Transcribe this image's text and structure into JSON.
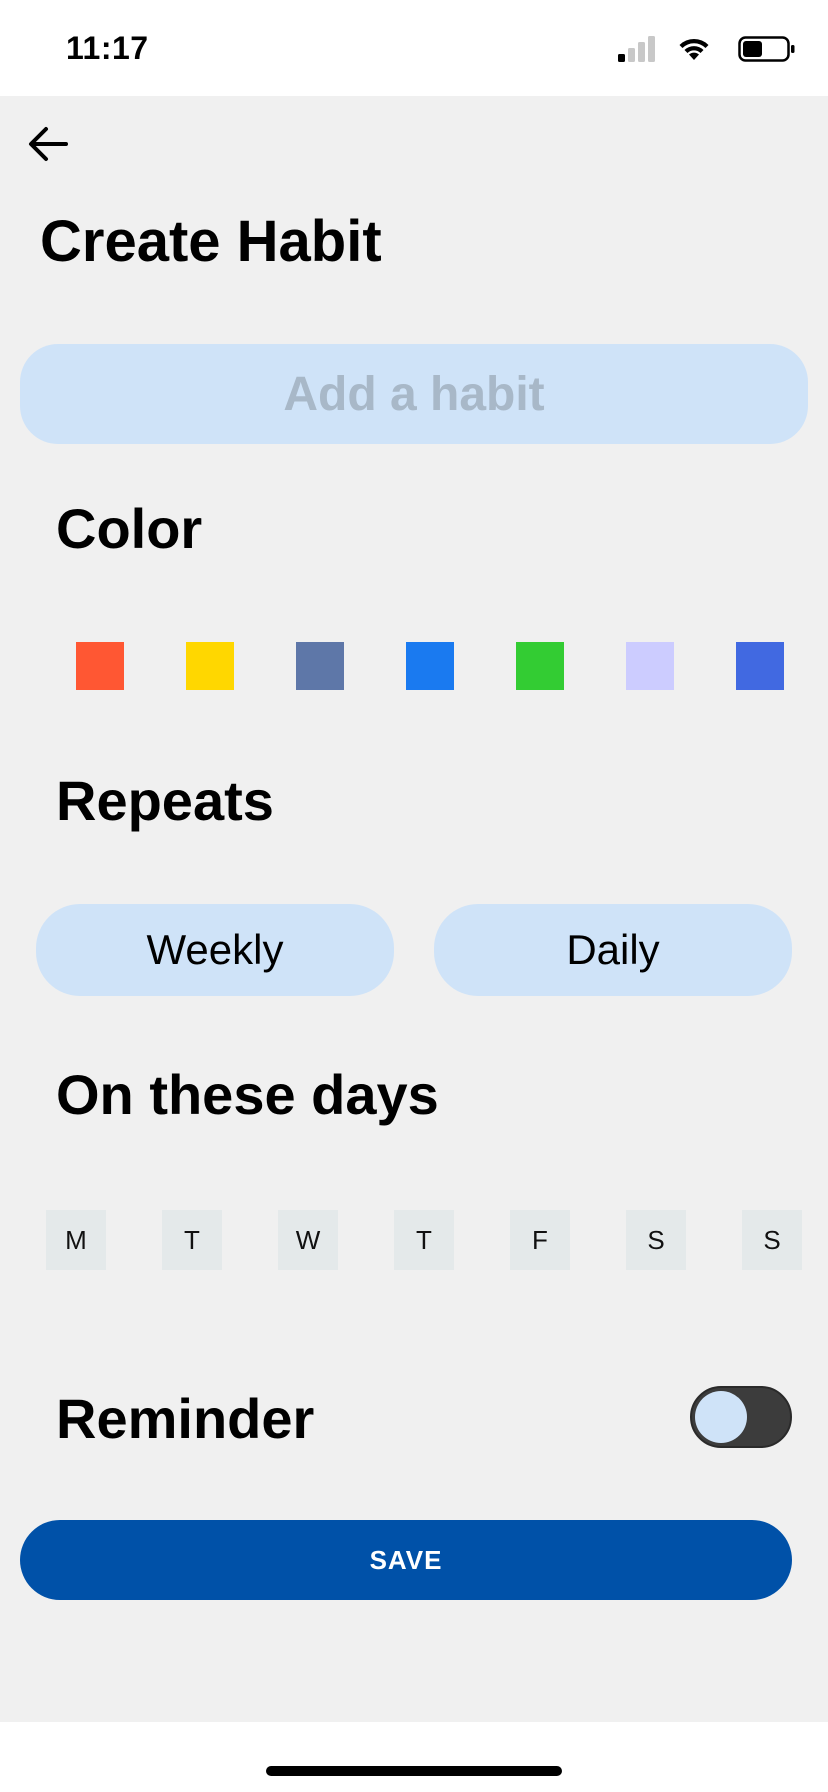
{
  "status_bar": {
    "time": "11:17",
    "signal_icon": "cellular-signal-icon",
    "wifi_icon": "wifi-icon",
    "battery_icon": "battery-icon",
    "battery_level": 0.45
  },
  "header": {
    "back_icon": "arrow-left-icon",
    "title": "Create Habit"
  },
  "habit_input": {
    "placeholder": "Add a habit",
    "value": ""
  },
  "color_section": {
    "heading": "Color",
    "swatches": [
      "#ff5733",
      "#ffd700",
      "#5e77a8",
      "#1a7af0",
      "#33cc33",
      "#ccccff",
      "#4169e1"
    ]
  },
  "repeats_section": {
    "heading": "Repeats",
    "options": [
      "Weekly",
      "Daily"
    ]
  },
  "days_section": {
    "heading": "On these days",
    "days": [
      "M",
      "T",
      "W",
      "T",
      "F",
      "S",
      "S"
    ]
  },
  "reminder_section": {
    "heading": "Reminder",
    "enabled": false
  },
  "actions": {
    "save_label": "SAVE"
  },
  "colors": {
    "background": "#f0f0f0",
    "accent_light": "#cfe3f8",
    "primary": "#0051a8",
    "day_chip": "#e4e9ea"
  }
}
